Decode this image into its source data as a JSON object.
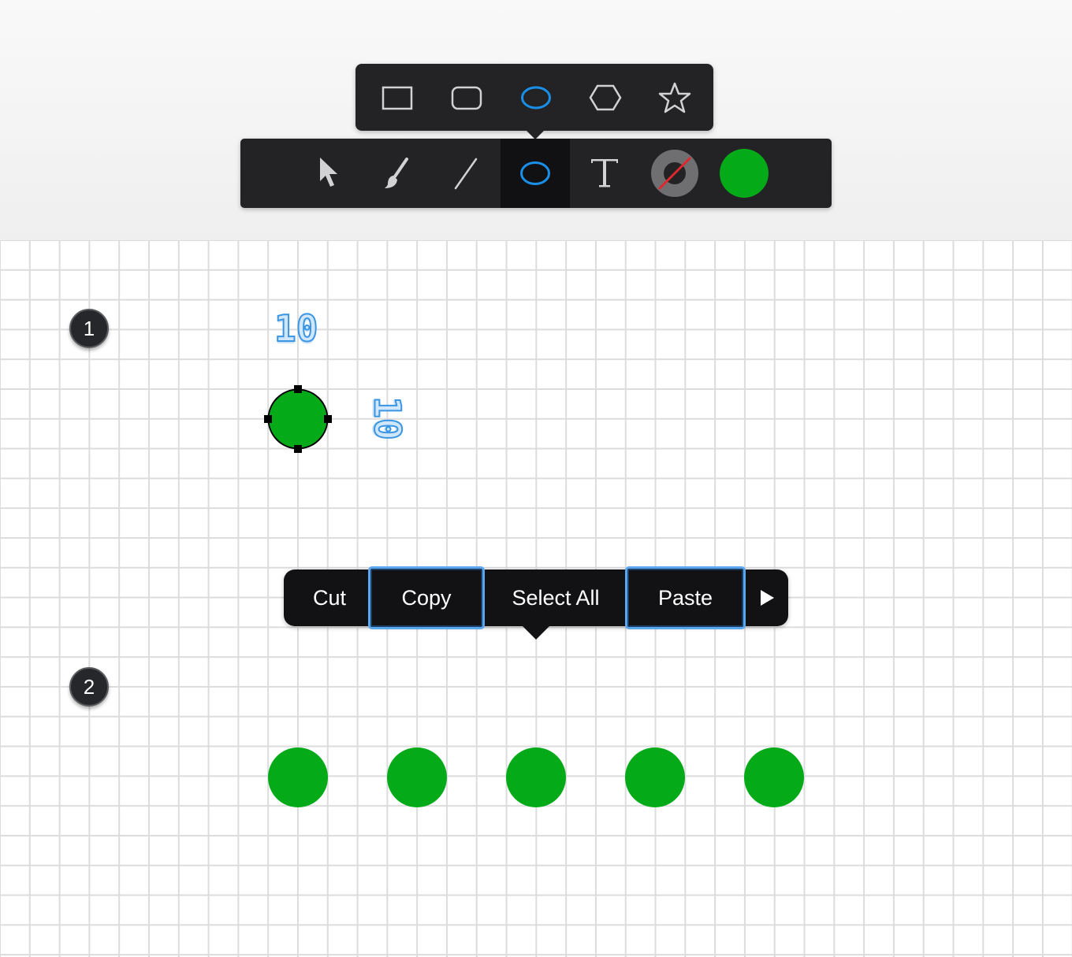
{
  "shape_picker": {
    "items": [
      {
        "name": "rectangle-shape",
        "icon": "rectangle-icon",
        "selected": false
      },
      {
        "name": "rounded-rectangle-shape",
        "icon": "rounded-rectangle-icon",
        "selected": false
      },
      {
        "name": "ellipse-shape",
        "icon": "ellipse-icon",
        "selected": true
      },
      {
        "name": "hexagon-shape",
        "icon": "hexagon-icon",
        "selected": false
      },
      {
        "name": "star-shape",
        "icon": "star-icon",
        "selected": false
      }
    ]
  },
  "toolbar": {
    "tools": [
      {
        "name": "select-tool",
        "icon": "arrow-pointer-icon"
      },
      {
        "name": "brush-tool",
        "icon": "brush-icon"
      },
      {
        "name": "line-tool",
        "icon": "line-icon"
      },
      {
        "name": "shape-tool",
        "icon": "ellipse-icon",
        "active": true
      },
      {
        "name": "text-tool",
        "icon": "text-icon"
      },
      {
        "name": "stroke-color",
        "icon": "no-stroke-icon"
      },
      {
        "name": "fill-color",
        "icon": "color-swatch-icon"
      }
    ]
  },
  "colors": {
    "accent": "#1a8fe8",
    "fill": "#05aa18",
    "toolbar_bg": "#232325",
    "stroke_none_line": "#e0282a"
  },
  "steps": {
    "step1": "1",
    "step2": "2"
  },
  "dimensions": {
    "width": "10",
    "height": "10"
  },
  "context_menu": {
    "cut": "Cut",
    "copy": "Copy",
    "select_all": "Select All",
    "paste": "Paste",
    "more_icon": "play-arrow-icon"
  },
  "result_circles": {
    "count": 5,
    "color": "#05aa18"
  }
}
